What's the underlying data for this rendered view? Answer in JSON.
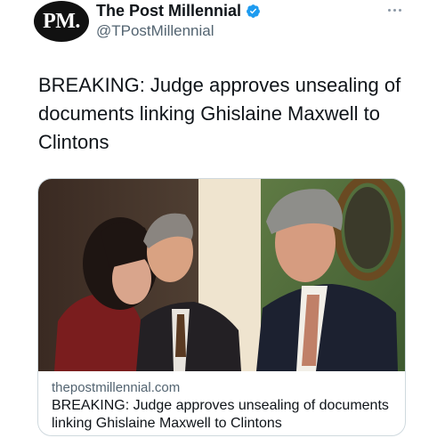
{
  "author": {
    "avatar_text": "PM.",
    "display_name": "The Post Millennial",
    "handle": "@TPostMillennial",
    "verified": true
  },
  "tweet": {
    "text": "BREAKING: Judge approves unsealing of documents linking Ghislaine Maxwell to Clintons"
  },
  "link_card": {
    "domain": "thepostmillennial.com",
    "title": "BREAKING: Judge approves unsealing of documents linking Ghislaine Maxwell to Clintons"
  },
  "colors": {
    "verified_badge": "#1d9bf0",
    "text_primary": "#0f1419",
    "text_secondary": "#536471",
    "card_border": "#cfd9de"
  }
}
